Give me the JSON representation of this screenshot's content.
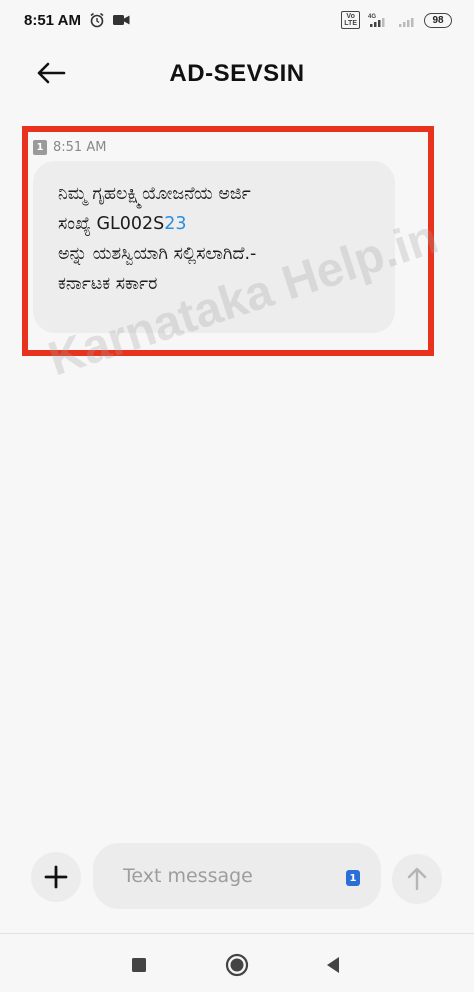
{
  "status_bar": {
    "time": "8:51 AM",
    "icons": [
      "alarm-icon",
      "video-icon",
      "volte-icon",
      "signal-icon",
      "signal-icon-2",
      "battery-icon"
    ],
    "network_badge_top": "Vo",
    "network_badge_bottom": "LTE",
    "network_type": "4G",
    "battery": "98"
  },
  "header": {
    "title": "AD-SEVSIN",
    "back_icon": "arrow-left-icon"
  },
  "message": {
    "sim_slot": "1",
    "time": "8:51 AM",
    "lines": [
      "ನಿಮ್ಮ ಗೃಹಲಕ್ಷ್ಮಿಯೋಜನೆಯ ಅರ್ಜಿ",
      "ಸಂಖ್ಯೆ GL002S",
      "ಅನ್ನು ಯಶಸ್ವಿಯಾಗಿ ಸಲ್ಲಿಸಲಾಗಿದೆ.-",
      "ಕರ್ನಾಟಕ ಸರ್ಕಾರ"
    ],
    "link_fragment": "23",
    "highlight_color": "#e8321e"
  },
  "watermark": "Karnataka Help.in",
  "composer": {
    "placeholder": "Text message",
    "sim_slot": "1",
    "add_icon": "plus-icon",
    "send_icon": "arrow-up-icon"
  },
  "nav": {
    "icons": [
      "square-recents-icon",
      "circle-home-icon",
      "triangle-back-icon"
    ]
  },
  "colors": {
    "accent": "#2b8ede",
    "sim_chip": "#2a6fd6",
    "highlight": "#e8321e"
  }
}
